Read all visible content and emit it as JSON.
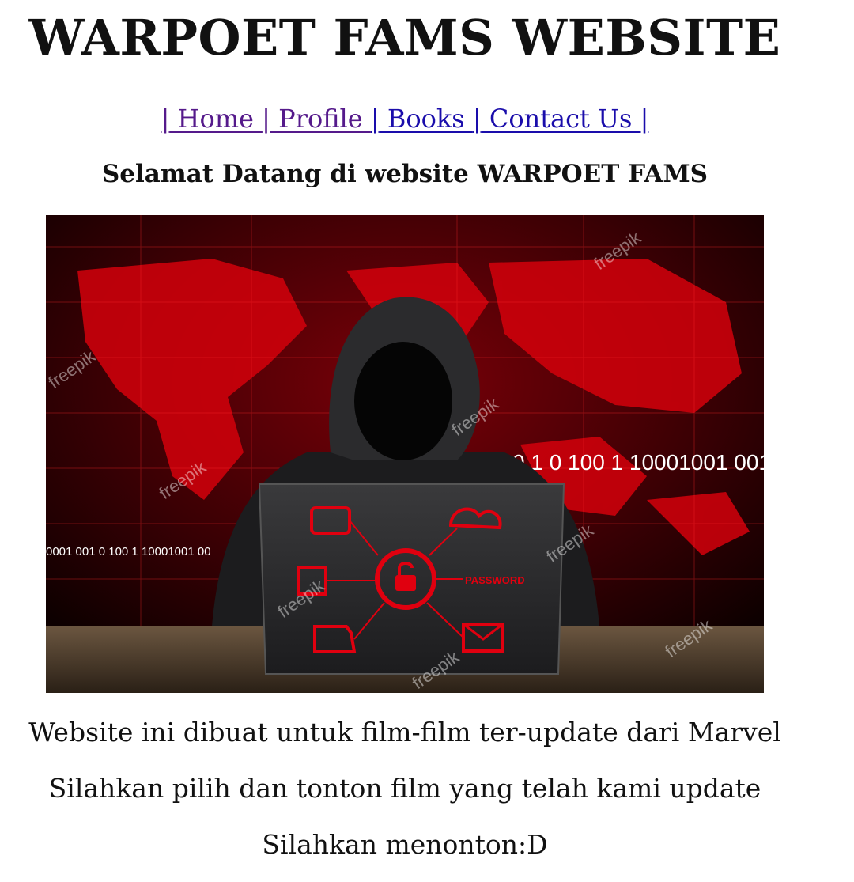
{
  "header": {
    "title": "WARPOET FAMS WEBSITE"
  },
  "nav": {
    "items": [
      {
        "label": " Home ",
        "state": "visited"
      },
      {
        "label": " Profile ",
        "state": "visited"
      },
      {
        "label": " Books ",
        "state": "link"
      },
      {
        "label": " Contact Us ",
        "state": "link"
      }
    ],
    "separator": "|"
  },
  "main": {
    "welcome": "Selamat Datang di website WARPOET FAMS",
    "hero_image": {
      "password_label": "PASSWORD",
      "binary_highlight_1": "0 1 0 100 1 10001001 001",
      "binary_highlight_2": "0001 001 0 100 1 10001001 00",
      "watermark": "freepik"
    },
    "paragraphs": [
      "Website ini dibuat untuk film-film ter-update dari Marvel",
      "Silahkan pilih dan tonton film yang telah kami update",
      "Silahkan menonton:D"
    ]
  },
  "colors": {
    "link": "#1a0dab",
    "visited_link": "#551a8b",
    "hero_red": "#e0000f",
    "hero_background": "#0d0000"
  }
}
